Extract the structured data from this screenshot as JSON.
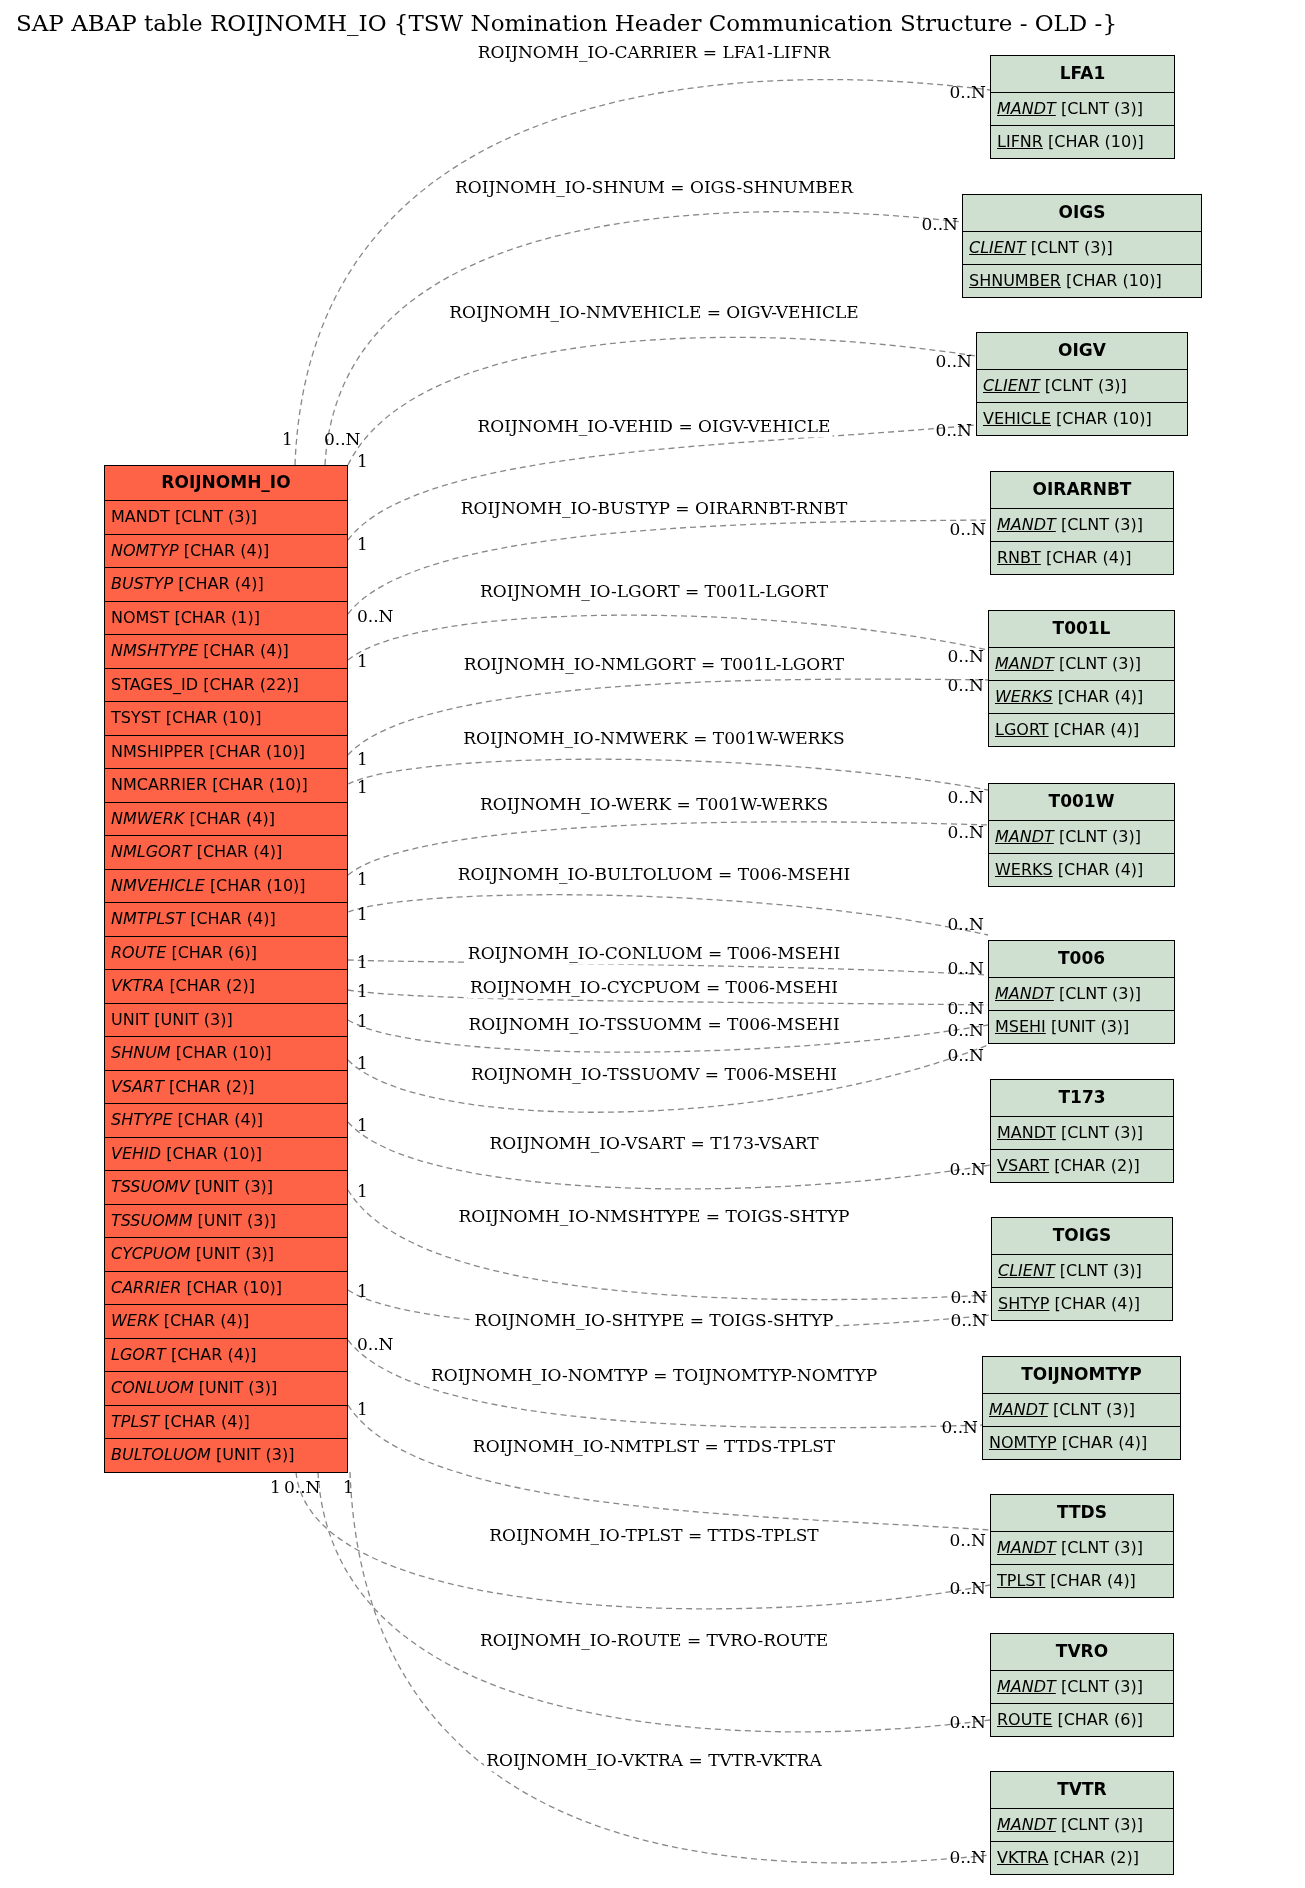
{
  "title": "SAP ABAP table ROIJNOMH_IO {TSW Nomination Header Communication Structure - OLD -}",
  "main_table": {
    "name": "ROIJNOMH_IO",
    "fields": [
      {
        "name": "MANDT",
        "type": "[CLNT (3)]",
        "italic": false
      },
      {
        "name": "NOMTYP",
        "type": "[CHAR (4)]",
        "italic": true
      },
      {
        "name": "BUSTYP",
        "type": "[CHAR (4)]",
        "italic": true
      },
      {
        "name": "NOMST",
        "type": "[CHAR (1)]",
        "italic": false
      },
      {
        "name": "NMSHTYPE",
        "type": "[CHAR (4)]",
        "italic": true
      },
      {
        "name": "STAGES_ID",
        "type": "[CHAR (22)]",
        "italic": false
      },
      {
        "name": "TSYST",
        "type": "[CHAR (10)]",
        "italic": false
      },
      {
        "name": "NMSHIPPER",
        "type": "[CHAR (10)]",
        "italic": false
      },
      {
        "name": "NMCARRIER",
        "type": "[CHAR (10)]",
        "italic": false
      },
      {
        "name": "NMWERK",
        "type": "[CHAR (4)]",
        "italic": true
      },
      {
        "name": "NMLGORT",
        "type": "[CHAR (4)]",
        "italic": true
      },
      {
        "name": "NMVEHICLE",
        "type": "[CHAR (10)]",
        "italic": true
      },
      {
        "name": "NMTPLST",
        "type": "[CHAR (4)]",
        "italic": true
      },
      {
        "name": "ROUTE",
        "type": "[CHAR (6)]",
        "italic": true
      },
      {
        "name": "VKTRA",
        "type": "[CHAR (2)]",
        "italic": true
      },
      {
        "name": "UNIT",
        "type": "[UNIT (3)]",
        "italic": false
      },
      {
        "name": "SHNUM",
        "type": "[CHAR (10)]",
        "italic": true
      },
      {
        "name": "VSART",
        "type": "[CHAR (2)]",
        "italic": true
      },
      {
        "name": "SHTYPE",
        "type": "[CHAR (4)]",
        "italic": true
      },
      {
        "name": "VEHID",
        "type": "[CHAR (10)]",
        "italic": true
      },
      {
        "name": "TSSUOMV",
        "type": "[UNIT (3)]",
        "italic": true
      },
      {
        "name": "TSSUOMM",
        "type": "[UNIT (3)]",
        "italic": true
      },
      {
        "name": "CYCPUOM",
        "type": "[UNIT (3)]",
        "italic": true
      },
      {
        "name": "CARRIER",
        "type": "[CHAR (10)]",
        "italic": true
      },
      {
        "name": "WERK",
        "type": "[CHAR (4)]",
        "italic": true
      },
      {
        "name": "LGORT",
        "type": "[CHAR (4)]",
        "italic": true
      },
      {
        "name": "CONLUOM",
        "type": "[UNIT (3)]",
        "italic": true
      },
      {
        "name": "TPLST",
        "type": "[CHAR (4)]",
        "italic": true
      },
      {
        "name": "BULTOLUOM",
        "type": "[UNIT (3)]",
        "italic": true
      }
    ]
  },
  "tables": [
    {
      "name": "LFA1",
      "fields": [
        {
          "name": "MANDT",
          "type": "[CLNT (3)]",
          "italic": true
        },
        {
          "name": "LIFNR",
          "type": "[CHAR (10)]",
          "italic": false
        }
      ]
    },
    {
      "name": "OIGS",
      "fields": [
        {
          "name": "CLIENT",
          "type": "[CLNT (3)]",
          "italic": true
        },
        {
          "name": "SHNUMBER",
          "type": "[CHAR (10)]",
          "italic": false
        }
      ]
    },
    {
      "name": "OIGV",
      "fields": [
        {
          "name": "CLIENT",
          "type": "[CLNT (3)]",
          "italic": true
        },
        {
          "name": "VEHICLE",
          "type": "[CHAR (10)]",
          "italic": false
        }
      ]
    },
    {
      "name": "OIRARNBT",
      "fields": [
        {
          "name": "MANDT",
          "type": "[CLNT (3)]",
          "italic": true
        },
        {
          "name": "RNBT",
          "type": "[CHAR (4)]",
          "italic": false
        }
      ]
    },
    {
      "name": "T001L",
      "fields": [
        {
          "name": "MANDT",
          "type": "[CLNT (3)]",
          "italic": true
        },
        {
          "name": "WERKS",
          "type": "[CHAR (4)]",
          "italic": true
        },
        {
          "name": "LGORT",
          "type": "[CHAR (4)]",
          "italic": false
        }
      ]
    },
    {
      "name": "T001W",
      "fields": [
        {
          "name": "MANDT",
          "type": "[CLNT (3)]",
          "italic": true
        },
        {
          "name": "WERKS",
          "type": "[CHAR (4)]",
          "italic": false
        }
      ]
    },
    {
      "name": "T006",
      "fields": [
        {
          "name": "MANDT",
          "type": "[CLNT (3)]",
          "italic": true
        },
        {
          "name": "MSEHI",
          "type": "[UNIT (3)]",
          "italic": false
        }
      ]
    },
    {
      "name": "T173",
      "fields": [
        {
          "name": "MANDT",
          "type": "[CLNT (3)]",
          "italic": false
        },
        {
          "name": "VSART",
          "type": "[CHAR (2)]",
          "italic": false
        }
      ]
    },
    {
      "name": "TOIGS",
      "fields": [
        {
          "name": "CLIENT",
          "type": "[CLNT (3)]",
          "italic": true
        },
        {
          "name": "SHTYP",
          "type": "[CHAR (4)]",
          "italic": false
        }
      ]
    },
    {
      "name": "TOIJNOMTYP",
      "fields": [
        {
          "name": "MANDT",
          "type": "[CLNT (3)]",
          "italic": true
        },
        {
          "name": "NOMTYP",
          "type": "[CHAR (4)]",
          "italic": false
        }
      ]
    },
    {
      "name": "TTDS",
      "fields": [
        {
          "name": "MANDT",
          "type": "[CLNT (3)]",
          "italic": true
        },
        {
          "name": "TPLST",
          "type": "[CHAR (4)]",
          "italic": false
        }
      ]
    },
    {
      "name": "TVRO",
      "fields": [
        {
          "name": "MANDT",
          "type": "[CLNT (3)]",
          "italic": true
        },
        {
          "name": "ROUTE",
          "type": "[CHAR (6)]",
          "italic": false
        }
      ]
    },
    {
      "name": "TVTR",
      "fields": [
        {
          "name": "MANDT",
          "type": "[CLNT (3)]",
          "italic": true
        },
        {
          "name": "VKTRA",
          "type": "[CHAR (2)]",
          "italic": false
        }
      ]
    }
  ],
  "relations": [
    {
      "label": "ROIJNOMH_IO-CARRIER = LFA1-LIFNR",
      "source_card": "1",
      "target_card": "0..N"
    },
    {
      "label": "ROIJNOMH_IO-SHNUM = OIGS-SHNUMBER",
      "source_card": "0..N",
      "target_card": "0..N"
    },
    {
      "label": "ROIJNOMH_IO-NMVEHICLE = OIGV-VEHICLE",
      "source_card": "1",
      "target_card": "0..N"
    },
    {
      "label": "ROIJNOMH_IO-VEHID = OIGV-VEHICLE",
      "source_card": "1",
      "target_card": "0..N"
    },
    {
      "label": "ROIJNOMH_IO-BUSTYP = OIRARNBT-RNBT",
      "source_card": "0..N",
      "target_card": "0..N"
    },
    {
      "label": "ROIJNOMH_IO-LGORT = T001L-LGORT",
      "source_card": "1",
      "target_card": "0..N"
    },
    {
      "label": "ROIJNOMH_IO-NMLGORT = T001L-LGORT",
      "source_card": "1",
      "target_card": "0..N"
    },
    {
      "label": "ROIJNOMH_IO-NMWERK = T001W-WERKS",
      "source_card": "1",
      "target_card": "0..N"
    },
    {
      "label": "ROIJNOMH_IO-WERK = T001W-WERKS",
      "source_card": "1",
      "target_card": "0..N"
    },
    {
      "label": "ROIJNOMH_IO-BULTOLUOM = T006-MSEHI",
      "source_card": "1",
      "target_card": "0..N"
    },
    {
      "label": "ROIJNOMH_IO-CONLUOM = T006-MSEHI",
      "source_card": "1",
      "target_card": "0..N"
    },
    {
      "label": "ROIJNOMH_IO-CYCPUOM = T006-MSEHI",
      "source_card": "1",
      "target_card": "0..N"
    },
    {
      "label": "ROIJNOMH_IO-TSSUOMM = T006-MSEHI",
      "source_card": "1",
      "target_card": "0..N"
    },
    {
      "label": "ROIJNOMH_IO-TSSUOMV = T006-MSEHI",
      "source_card": "1",
      "target_card": "0..N"
    },
    {
      "label": "ROIJNOMH_IO-VSART = T173-VSART",
      "source_card": "1",
      "target_card": "0..N"
    },
    {
      "label": "ROIJNOMH_IO-NMSHTYPE = TOIGS-SHTYP",
      "source_card": "1",
      "target_card": "0..N"
    },
    {
      "label": "ROIJNOMH_IO-SHTYPE = TOIGS-SHTYP",
      "source_card": "1",
      "target_card": "0..N"
    },
    {
      "label": "ROIJNOMH_IO-NOMTYP = TOIJNOMTYP-NOMTYP",
      "source_card": "0..N",
      "target_card": "0..N"
    },
    {
      "label": "ROIJNOMH_IO-NMTPLST = TTDS-TPLST",
      "source_card": "1",
      "target_card": "0..N"
    },
    {
      "label": "ROIJNOMH_IO-TPLST = TTDS-TPLST",
      "source_card": "1",
      "target_card": "0..N"
    },
    {
      "label": "ROIJNOMH_IO-ROUTE = TVRO-ROUTE",
      "source_card": "0..N",
      "target_card": "0..N"
    },
    {
      "label": "ROIJNOMH_IO-VKTRA = TVTR-VKTRA",
      "source_card": "1",
      "target_card": "0..N"
    }
  ]
}
